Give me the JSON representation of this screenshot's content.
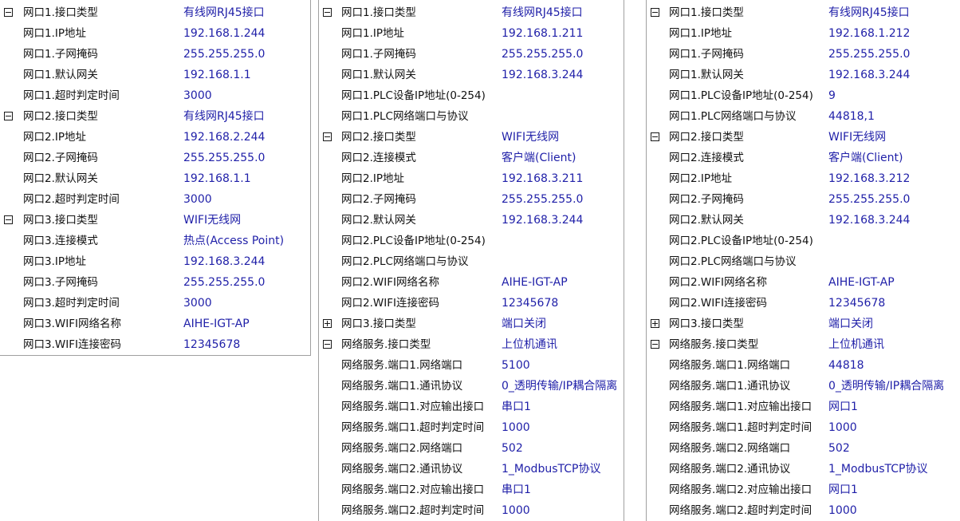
{
  "panels": [
    {
      "rows": [
        {
          "label": "网口1.接口类型",
          "value": "有线网RJ45接口",
          "toggle": "minus"
        },
        {
          "label": "网口1.IP地址",
          "value": "192.168.1.244"
        },
        {
          "label": "网口1.子网掩码",
          "value": "255.255.255.0"
        },
        {
          "label": "网口1.默认网关",
          "value": "192.168.1.1"
        },
        {
          "label": "网口1.超时判定时间",
          "value": "3000"
        },
        {
          "label": "网口2.接口类型",
          "value": "有线网RJ45接口",
          "toggle": "minus"
        },
        {
          "label": "网口2.IP地址",
          "value": "192.168.2.244"
        },
        {
          "label": "网口2.子网掩码",
          "value": "255.255.255.0"
        },
        {
          "label": "网口2.默认网关",
          "value": "192.168.1.1"
        },
        {
          "label": "网口2.超时判定时间",
          "value": "3000"
        },
        {
          "label": "网口3.接口类型",
          "value": "WIFI无线网",
          "toggle": "minus"
        },
        {
          "label": "网口3.连接模式",
          "value": "热点(Access Point)"
        },
        {
          "label": "网口3.IP地址",
          "value": "192.168.3.244"
        },
        {
          "label": "网口3.子网掩码",
          "value": "255.255.255.0"
        },
        {
          "label": "网口3.超时判定时间",
          "value": "3000"
        },
        {
          "label": "网口3.WIFI网络名称",
          "value": "AIHE-IGT-AP"
        },
        {
          "label": "网口3.WIFI连接密码",
          "value": "12345678"
        }
      ]
    },
    {
      "rows": [
        {
          "label": "网口1.接口类型",
          "value": "有线网RJ45接口",
          "toggle": "minus"
        },
        {
          "label": "网口1.IP地址",
          "value": "192.168.1.211"
        },
        {
          "label": "网口1.子网掩码",
          "value": "255.255.255.0"
        },
        {
          "label": "网口1.默认网关",
          "value": "192.168.3.244"
        },
        {
          "label": "网口1.PLC设备IP地址(0-254)",
          "value": ""
        },
        {
          "label": "网口1.PLC网络端口与协议",
          "value": ""
        },
        {
          "label": "网口2.接口类型",
          "value": "WIFI无线网",
          "toggle": "minus"
        },
        {
          "label": "网口2.连接模式",
          "value": "客户端(Client)"
        },
        {
          "label": "网口2.IP地址",
          "value": "192.168.3.211"
        },
        {
          "label": "网口2.子网掩码",
          "value": "255.255.255.0"
        },
        {
          "label": "网口2.默认网关",
          "value": "192.168.3.244"
        },
        {
          "label": "网口2.PLC设备IP地址(0-254)",
          "value": ""
        },
        {
          "label": "网口2.PLC网络端口与协议",
          "value": ""
        },
        {
          "label": "网口2.WIFI网络名称",
          "value": "AIHE-IGT-AP"
        },
        {
          "label": "网口2.WIFI连接密码",
          "value": "12345678"
        },
        {
          "label": "网口3.接口类型",
          "value": "端口关闭",
          "toggle": "plus"
        },
        {
          "label": "网络服务.接口类型",
          "value": "上位机通讯",
          "toggle": "minus"
        },
        {
          "label": "网络服务.端口1.网络端口",
          "value": "5100"
        },
        {
          "label": "网络服务.端口1.通讯协议",
          "value": "0_透明传输/IP耦合隔离"
        },
        {
          "label": "网络服务.端口1.对应输出接口",
          "value": "串口1"
        },
        {
          "label": "网络服务.端口1.超时判定时间",
          "value": "1000"
        },
        {
          "label": "网络服务.端口2.网络端口",
          "value": "502"
        },
        {
          "label": "网络服务.端口2.通讯协议",
          "value": "1_ModbusTCP协议"
        },
        {
          "label": "网络服务.端口2.对应输出接口",
          "value": "串口1"
        },
        {
          "label": "网络服务.端口2.超时判定时间",
          "value": "1000"
        }
      ]
    },
    {
      "rows": [
        {
          "label": "网口1.接口类型",
          "value": "有线网RJ45接口",
          "toggle": "minus"
        },
        {
          "label": "网口1.IP地址",
          "value": "192.168.1.212"
        },
        {
          "label": "网口1.子网掩码",
          "value": "255.255.255.0"
        },
        {
          "label": "网口1.默认网关",
          "value": "192.168.3.244"
        },
        {
          "label": "网口1.PLC设备IP地址(0-254)",
          "value": "9"
        },
        {
          "label": "网口1.PLC网络端口与协议",
          "value": "44818,1"
        },
        {
          "label": "网口2.接口类型",
          "value": "WIFI无线网",
          "toggle": "minus"
        },
        {
          "label": "网口2.连接模式",
          "value": "客户端(Client)"
        },
        {
          "label": "网口2.IP地址",
          "value": "192.168.3.212"
        },
        {
          "label": "网口2.子网掩码",
          "value": "255.255.255.0"
        },
        {
          "label": "网口2.默认网关",
          "value": "192.168.3.244"
        },
        {
          "label": "网口2.PLC设备IP地址(0-254)",
          "value": ""
        },
        {
          "label": "网口2.PLC网络端口与协议",
          "value": ""
        },
        {
          "label": "网口2.WIFI网络名称",
          "value": "AIHE-IGT-AP"
        },
        {
          "label": "网口2.WIFI连接密码",
          "value": "12345678"
        },
        {
          "label": "网口3.接口类型",
          "value": "端口关闭",
          "toggle": "plus"
        },
        {
          "label": "网络服务.接口类型",
          "value": "上位机通讯",
          "toggle": "minus"
        },
        {
          "label": "网络服务.端口1.网络端口",
          "value": "44818"
        },
        {
          "label": "网络服务.端口1.通讯协议",
          "value": "0_透明传输/IP耦合隔离"
        },
        {
          "label": "网络服务.端口1.对应输出接口",
          "value": "网口1"
        },
        {
          "label": "网络服务.端口1.超时判定时间",
          "value": "1000"
        },
        {
          "label": "网络服务.端口2.网络端口",
          "value": "502"
        },
        {
          "label": "网络服务.端口2.通讯协议",
          "value": "1_ModbusTCP协议"
        },
        {
          "label": "网络服务.端口2.对应输出接口",
          "value": "网口1"
        },
        {
          "label": "网络服务.端口2.超时判定时间",
          "value": "1000"
        }
      ]
    }
  ]
}
